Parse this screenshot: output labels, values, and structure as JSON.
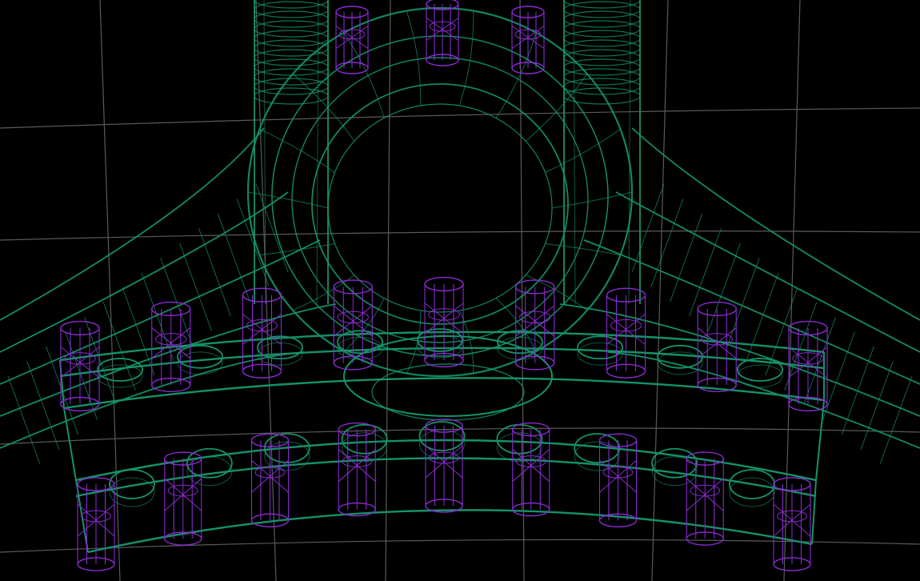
{
  "viewport": {
    "mode": "wireframe",
    "background_color": "#000000",
    "grid_color": "#5a5a5a",
    "grid_visible": true
  },
  "scene": {
    "part_color": "#14936a",
    "fastener_color": "#8a2bd0",
    "fastener_rows": [
      {
        "name": "top-bolt-row",
        "count": 3
      },
      {
        "name": "upper-flange-bolt-row",
        "count": 9
      },
      {
        "name": "lower-flange-bolt-row",
        "count": 9
      }
    ],
    "flange_holes": {
      "upper_count": 9,
      "lower_count": 9
    }
  }
}
